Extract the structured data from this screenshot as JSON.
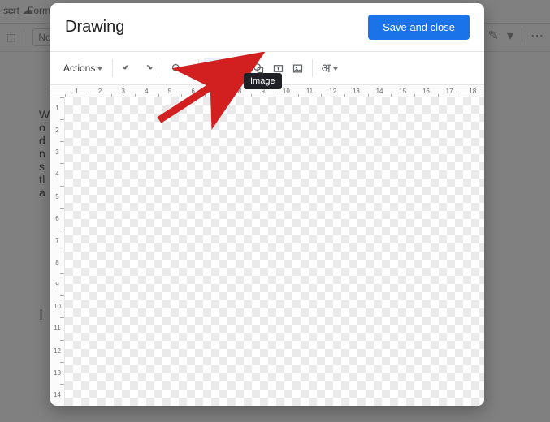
{
  "background_docs": {
    "menubar": {
      "insert": "sert",
      "format": "Form"
    },
    "toolbar": {
      "style_selector": "Nor"
    },
    "right_tools": {
      "pencil_icon": "✎",
      "more_icon": "⋯"
    },
    "body_lines": [
      "W",
      "o",
      "d",
      "n",
      "s",
      "tl",
      "a"
    ],
    "cursor_line": "I"
  },
  "modal": {
    "title": "Drawing",
    "save_label": "Save and close",
    "toolbar": {
      "actions_label": "Actions",
      "undo_title": "Undo",
      "redo_title": "Redo",
      "zoom_title": "Zoom",
      "select_title": "Select",
      "line_title": "Line",
      "shape_title": "Shape",
      "textbox_title": "Text box",
      "image_title": "Image",
      "textstyle_title": "Text style",
      "textstyle_glyph": "अ"
    },
    "tooltip": "Image",
    "ruler_h": [
      1,
      2,
      3,
      4,
      5,
      6,
      7,
      8,
      9,
      10,
      11,
      12,
      13,
      14,
      15,
      16,
      17,
      18
    ],
    "ruler_v": [
      1,
      2,
      3,
      4,
      5,
      6,
      7,
      8,
      9,
      10,
      11,
      12,
      13,
      14
    ]
  },
  "annotation": {
    "color": "#d21f1f"
  }
}
